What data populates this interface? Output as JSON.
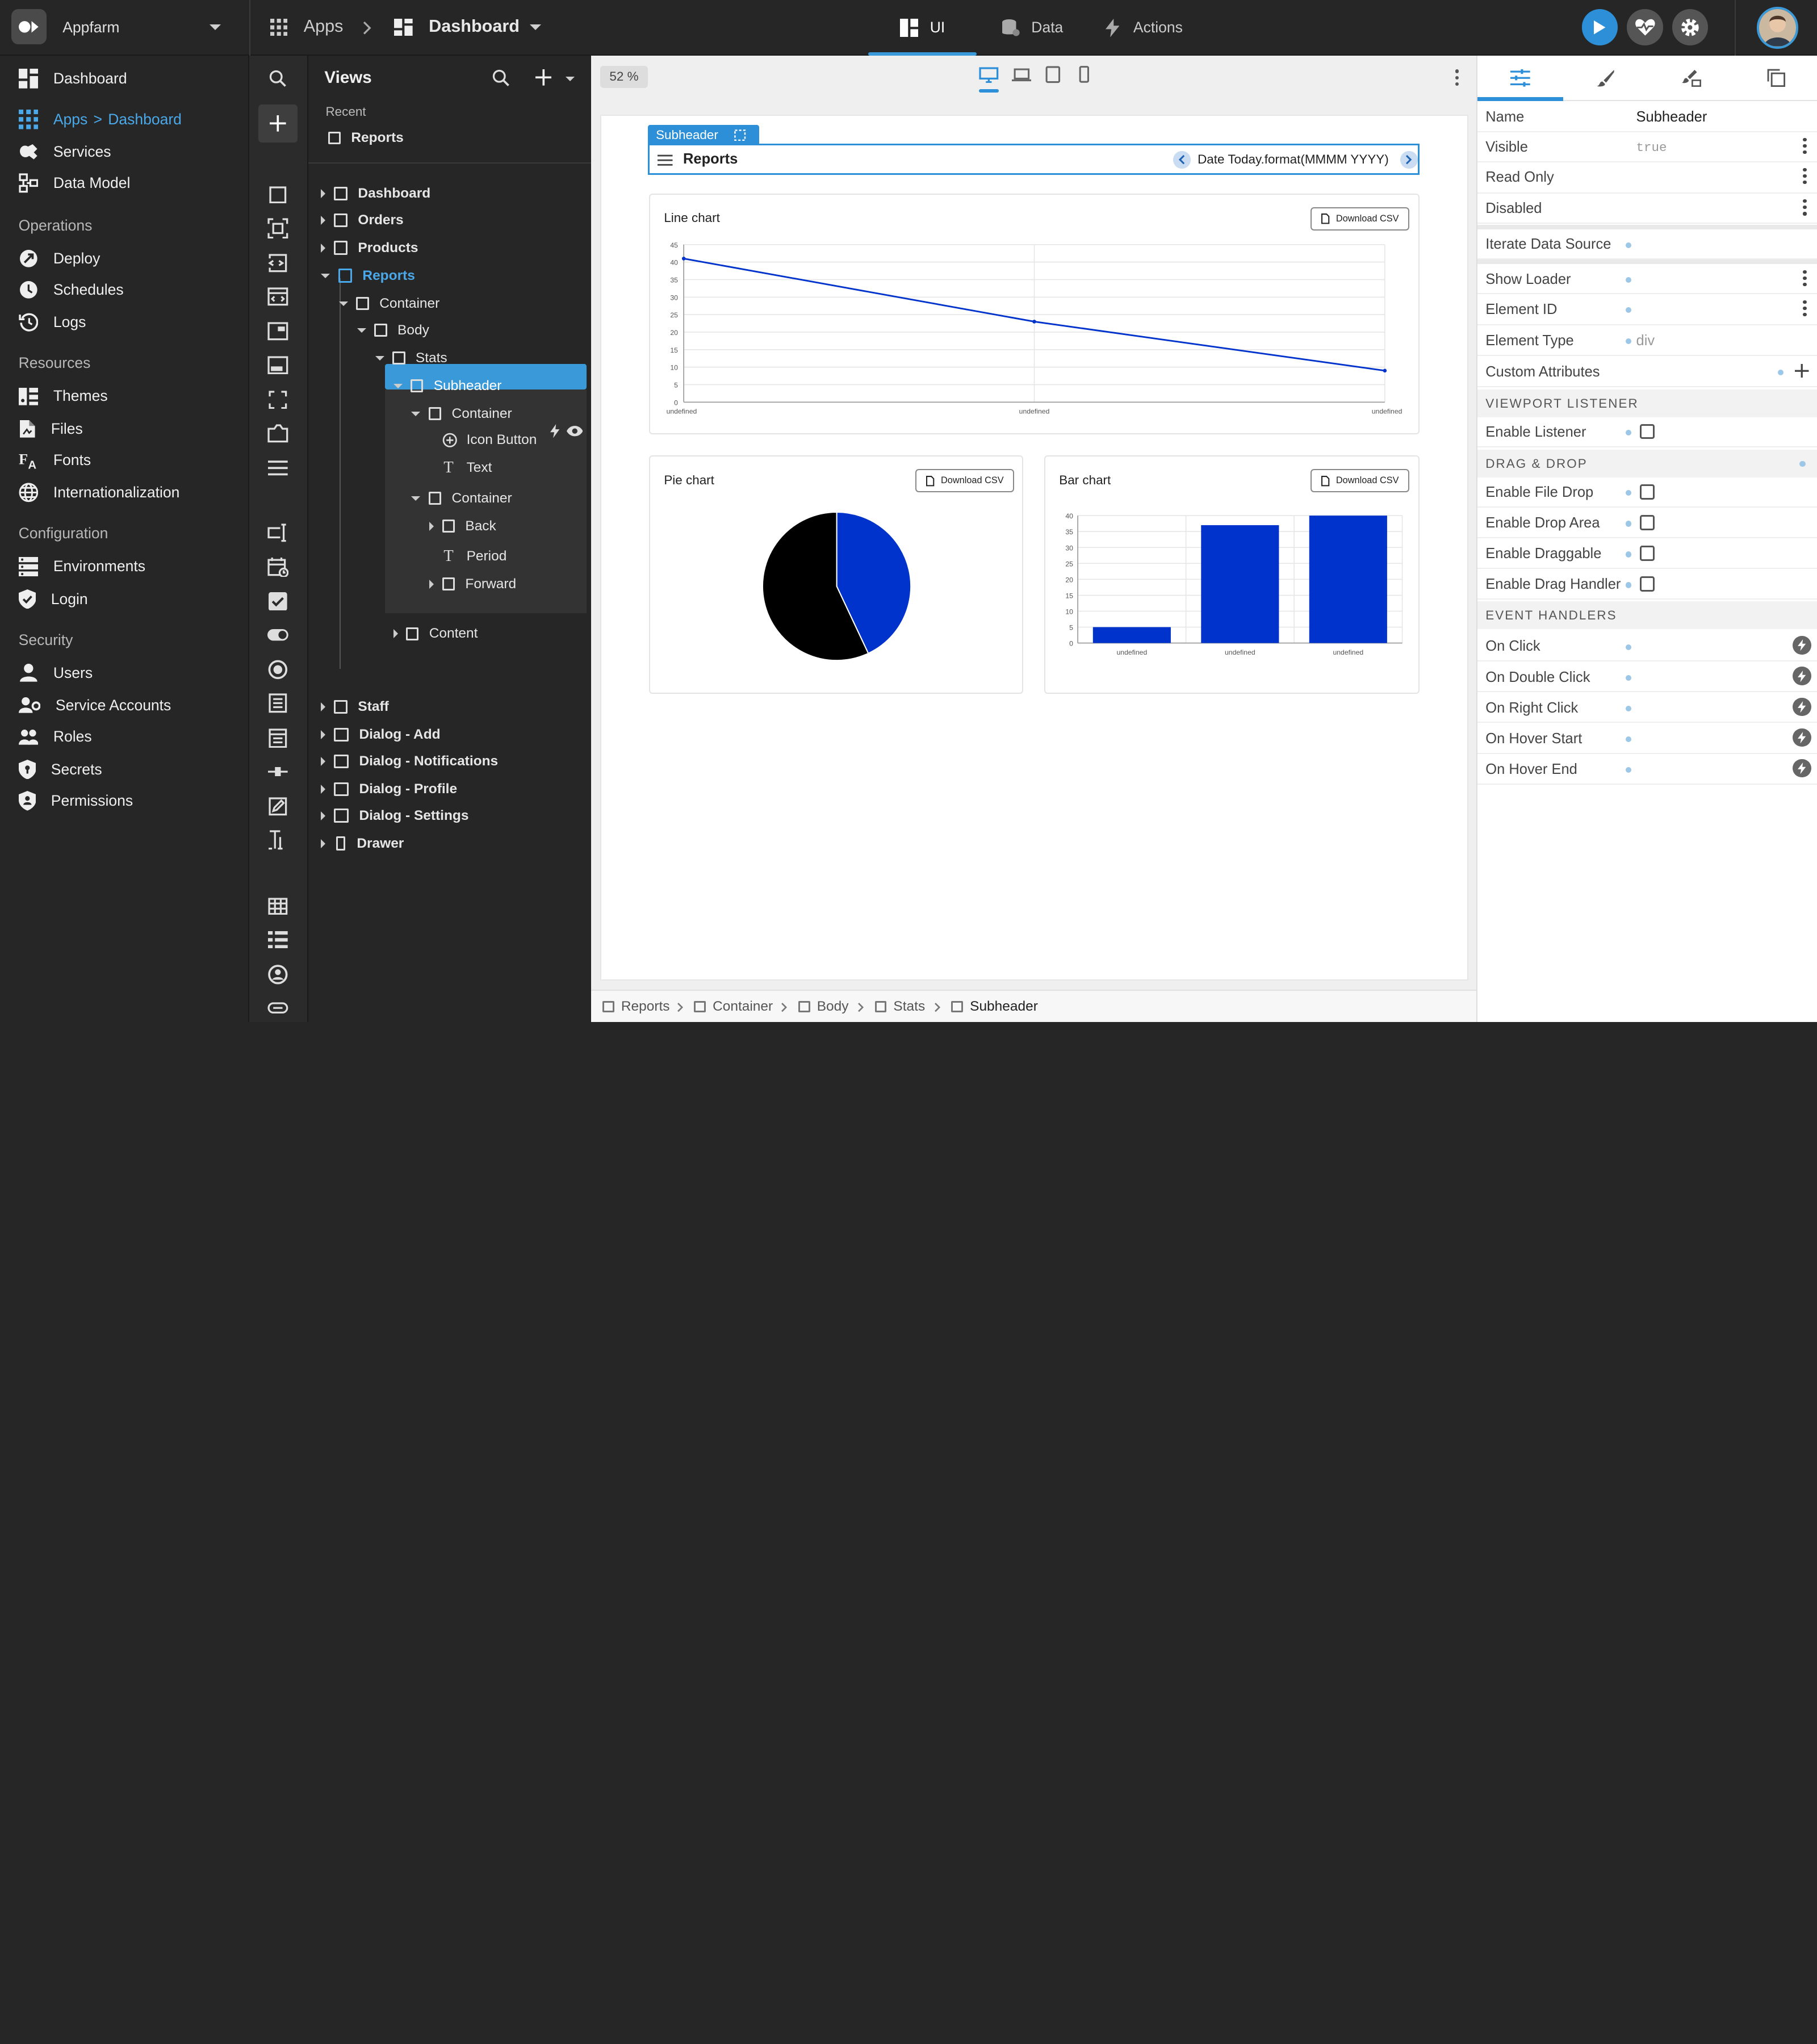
{
  "topbar": {
    "workspace": "Appfarm",
    "apps": "Apps",
    "current": "Dashboard",
    "tabs": [
      {
        "label": "UI",
        "active": true
      },
      {
        "label": "Data",
        "active": false
      },
      {
        "label": "Actions",
        "active": false
      }
    ]
  },
  "leftnav": {
    "items_top": [
      {
        "label": "Dashboard",
        "icon": "dashboard-icon"
      }
    ],
    "apps_breadcrumb": {
      "apps": "Apps",
      "sep": ">",
      "page": "Dashboard"
    },
    "items_core": [
      {
        "label": "Services",
        "icon": "services-icon"
      },
      {
        "label": "Data Model",
        "icon": "data-model-icon"
      }
    ],
    "sections": [
      {
        "title": "Operations",
        "items": [
          {
            "label": "Deploy",
            "icon": "deploy-icon"
          },
          {
            "label": "Schedules",
            "icon": "clock-icon"
          },
          {
            "label": "Logs",
            "icon": "history-icon"
          }
        ]
      },
      {
        "title": "Resources",
        "items": [
          {
            "label": "Themes",
            "icon": "themes-icon"
          },
          {
            "label": "Files",
            "icon": "file-icon"
          },
          {
            "label": "Fonts",
            "icon": "font-icon"
          },
          {
            "label": "Internationalization",
            "icon": "globe-icon"
          }
        ]
      },
      {
        "title": "Configuration",
        "items": [
          {
            "label": "Environments",
            "icon": "server-icon"
          },
          {
            "label": "Login",
            "icon": "shield-check-icon"
          }
        ]
      },
      {
        "title": "Security",
        "items": [
          {
            "label": "Users",
            "icon": "user-icon"
          },
          {
            "label": "Service Accounts",
            "icon": "service-account-icon"
          },
          {
            "label": "Roles",
            "icon": "group-icon"
          },
          {
            "label": "Secrets",
            "icon": "secret-shield-icon"
          },
          {
            "label": "Permissions",
            "icon": "permissions-shield-icon"
          }
        ]
      }
    ]
  },
  "views": {
    "title": "Views",
    "recent_label": "Recent",
    "recent_item": "Reports",
    "tree": [
      {
        "label": "Dashboard",
        "depth": 0,
        "arrow": "right",
        "bold": true
      },
      {
        "label": "Orders",
        "depth": 0,
        "arrow": "right",
        "bold": true
      },
      {
        "label": "Products",
        "depth": 0,
        "arrow": "right",
        "bold": true
      },
      {
        "label": "Reports",
        "depth": 0,
        "arrow": "down",
        "bold": true,
        "active": true
      },
      {
        "label": "Container",
        "depth": 1,
        "arrow": "down"
      },
      {
        "label": "Body",
        "depth": 2,
        "arrow": "down"
      },
      {
        "label": "Stats",
        "depth": 3,
        "arrow": "down"
      },
      {
        "label": "Subheader",
        "depth": 4,
        "arrow": "down",
        "selected": true
      },
      {
        "label": "Container",
        "depth": 5,
        "arrow": "down"
      },
      {
        "label": "Icon Button",
        "depth": 6,
        "icon": "plus-circle"
      },
      {
        "label": "Text",
        "depth": 6,
        "icon": "text"
      },
      {
        "label": "Container",
        "depth": 5,
        "arrow": "down"
      },
      {
        "label": "Back",
        "depth": 6,
        "arrow": "right"
      },
      {
        "label": "Period",
        "depth": 6,
        "icon": "text"
      },
      {
        "label": "Forward",
        "depth": 6,
        "arrow": "right"
      },
      {
        "label": "Content",
        "depth": 4,
        "arrow": "right"
      },
      {
        "label": "Staff",
        "depth": 0,
        "arrow": "right",
        "bold": true
      },
      {
        "label": "Dialog - Add",
        "depth": 0,
        "arrow": "right",
        "bold": true,
        "wide": true
      },
      {
        "label": "Dialog - Notifications",
        "depth": 0,
        "arrow": "right",
        "bold": true,
        "wide": true
      },
      {
        "label": "Dialog - Profile",
        "depth": 0,
        "arrow": "right",
        "bold": true,
        "wide": true
      },
      {
        "label": "Dialog - Settings",
        "depth": 0,
        "arrow": "right",
        "bold": true,
        "wide": true
      },
      {
        "label": "Drawer",
        "depth": 0,
        "arrow": "right",
        "bold": true,
        "narrow": true
      }
    ]
  },
  "canvas": {
    "zoom": "52 %",
    "subheader_tag": "Subheader",
    "subheader_title": "Reports",
    "period": "Date Today.format(MMMM YYYY)",
    "download_label": "Download CSV",
    "charts_titles": {
      "line": "Line chart",
      "pie": "Pie chart",
      "bar": "Bar chart"
    }
  },
  "chart_data": [
    {
      "type": "line",
      "title": "Line chart",
      "categories": [
        "undefined",
        "undefined",
        "undefined"
      ],
      "values": [
        41,
        23,
        9
      ],
      "ylim": [
        0,
        45
      ],
      "yticks": [
        0,
        5,
        10,
        15,
        20,
        25,
        30,
        35,
        40,
        45
      ],
      "color": "#0033cc"
    },
    {
      "type": "pie",
      "title": "Pie chart",
      "slices": [
        43,
        57
      ],
      "colors": [
        "#0033cc",
        "#000000"
      ]
    },
    {
      "type": "bar",
      "title": "Bar chart",
      "categories": [
        "undefined",
        "undefined",
        "undefined"
      ],
      "values": [
        5,
        37,
        40
      ],
      "ylim": [
        0,
        40
      ],
      "yticks": [
        0,
        5,
        10,
        15,
        20,
        25,
        30,
        35,
        40
      ],
      "color": "#0033cc"
    }
  ],
  "breadcrumb": [
    "Reports",
    "Container",
    "Body",
    "Stats",
    "Subheader"
  ],
  "props": {
    "rows": [
      {
        "label": "Name",
        "value": "Subheader"
      },
      {
        "label": "Visible",
        "value": "true",
        "mono": true,
        "kebab": true
      },
      {
        "label": "Read Only",
        "kebab": true
      },
      {
        "label": "Disabled",
        "kebab": true
      },
      {
        "label": "Iterate Data Source",
        "dot": true
      },
      {
        "label": "Show Loader",
        "dot": true,
        "kebab": true
      },
      {
        "label": "Element ID",
        "dot": true,
        "kebab": true
      },
      {
        "label": "Element Type",
        "value": "div",
        "dot": true
      },
      {
        "label": "Custom Attributes"
      }
    ],
    "viewport_title": "VIEWPORT LISTENER",
    "viewport_rows": [
      "Enable Listener"
    ],
    "dragdrop_title": "DRAG & DROP",
    "dragdrop_rows": [
      "Enable File Drop",
      "Enable Drop Area",
      "Enable Draggable",
      "Enable Drag Handler"
    ],
    "events_title": "EVENT HANDLERS",
    "events_rows": [
      "On Click",
      "On Double Click",
      "On Right Click",
      "On Hover Start",
      "On Hover End"
    ]
  }
}
